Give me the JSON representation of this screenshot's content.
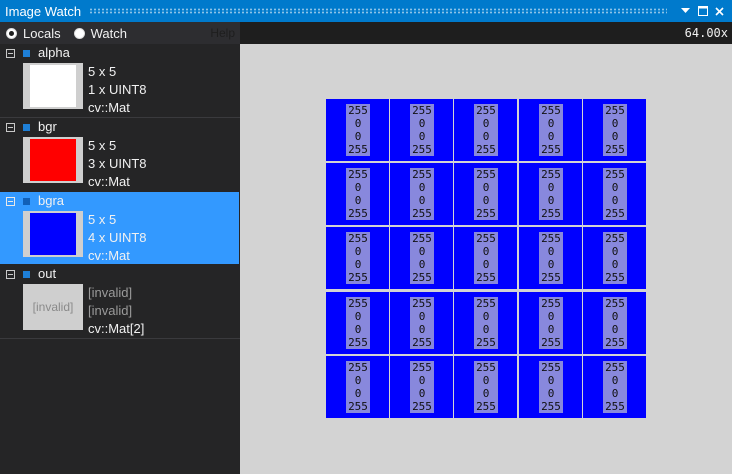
{
  "window": {
    "title": "Image Watch"
  },
  "toolbar": {
    "locals_label": "Locals",
    "watch_label": "Watch",
    "help_label": "Help",
    "selected": "Locals"
  },
  "viewer": {
    "zoom": "64.00x"
  },
  "variables": [
    {
      "name": "alpha",
      "size": "5 x 5",
      "type": "1 x UINT8",
      "class": "cv::Mat",
      "thumb_color": "#ffffff"
    },
    {
      "name": "bgr",
      "size": "5 x 5",
      "type": "3 x UINT8",
      "class": "cv::Mat",
      "thumb_color": "#ff0000"
    },
    {
      "name": "bgra",
      "size": "5 x 5",
      "type": "4 x UINT8",
      "class": "cv::Mat",
      "thumb_color": "#0000ff"
    },
    {
      "name": "out",
      "size": "[invalid]",
      "type": "[invalid]",
      "class": "cv::Mat[2]",
      "thumb_text": "[invalid]"
    }
  ],
  "image": {
    "rows": 5,
    "cols": 5,
    "pixel": {
      "b": "255",
      "g": "0",
      "r": "0",
      "a": "255"
    },
    "pixel_color": "#0000ff"
  }
}
